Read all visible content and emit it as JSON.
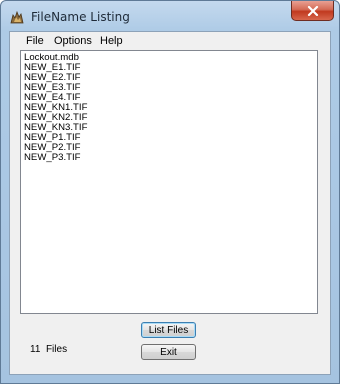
{
  "window": {
    "title": "FileName Listing"
  },
  "menu": [
    "File",
    "Options",
    "Help"
  ],
  "files": [
    "Lockout.mdb",
    "NEW_E1.TIF",
    "NEW_E2.TIF",
    "NEW_E3.TIF",
    "NEW_E4.TIF",
    "NEW_KN1.TIF",
    "NEW_KN2.TIF",
    "NEW_KN3.TIF",
    "NEW_P1.TIF",
    "NEW_P2.TIF",
    "NEW_P3.TIF"
  ],
  "buttons": {
    "list_files": "List Files",
    "exit": "Exit"
  },
  "status": {
    "count": "11",
    "unit": "Files"
  },
  "icons": {
    "app": "app-icon",
    "close": "close-icon"
  },
  "colors": {
    "close_button": "#c0391f",
    "frame": "#aecbe6"
  }
}
